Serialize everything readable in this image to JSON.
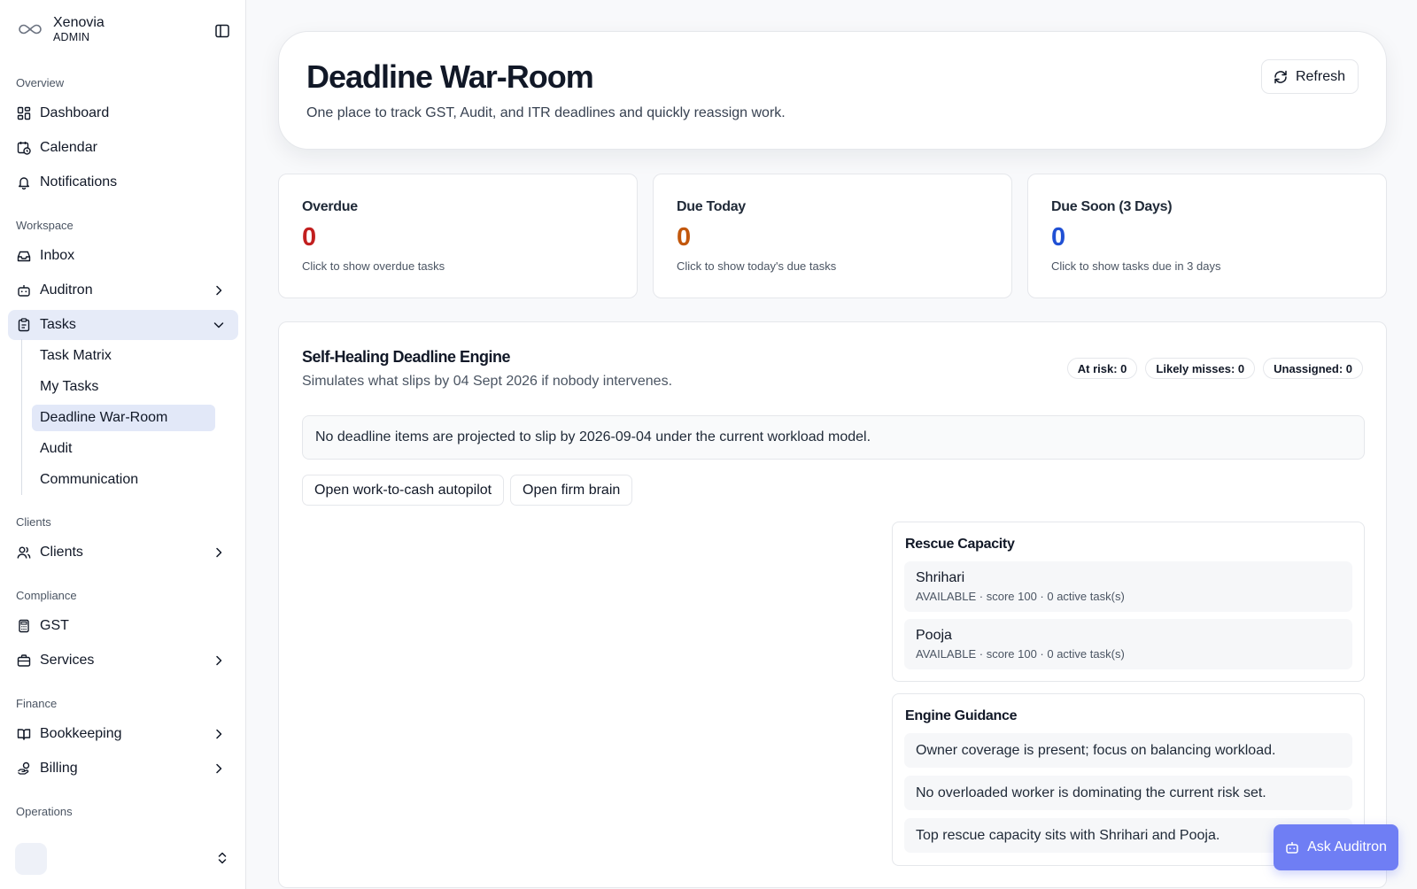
{
  "brand": {
    "name": "Xenovia",
    "role": "ADMIN"
  },
  "sidebar": {
    "sections": {
      "overview": "Overview",
      "workspace": "Workspace",
      "clients": "Clients",
      "compliance": "Compliance",
      "finance": "Finance",
      "operations": "Operations"
    },
    "items": {
      "dashboard": "Dashboard",
      "calendar": "Calendar",
      "notifications": "Notifications",
      "inbox": "Inbox",
      "auditron": "Auditron",
      "tasks": "Tasks",
      "clients": "Clients",
      "gst": "GST",
      "services": "Services",
      "bookkeeping": "Bookkeeping",
      "billing": "Billing"
    },
    "task_sub": {
      "task_matrix": "Task Matrix",
      "my_tasks": "My Tasks",
      "war_room": "Deadline War-Room",
      "audit": "Audit",
      "communication": "Communication"
    }
  },
  "header": {
    "title": "Deadline War-Room",
    "subtitle": "One place to track GST, Audit, and ITR deadlines and quickly reassign work.",
    "refresh_label": "Refresh"
  },
  "stats": [
    {
      "title": "Overdue",
      "value": "0",
      "desc": "Click to show overdue tasks",
      "color": "#c21f1f"
    },
    {
      "title": "Due Today",
      "value": "0",
      "desc": "Click to show today's due tasks",
      "color": "#c2570c"
    },
    {
      "title": "Due Soon (3 Days)",
      "value": "0",
      "desc": "Click to show tasks due in 3 days",
      "color": "#2050d4"
    }
  ],
  "engine": {
    "title": "Self-Healing Deadline Engine",
    "subtitle": "Simulates what slips by 04 Sept 2026 if nobody intervenes.",
    "pills": {
      "at_risk": "At risk: 0",
      "likely_misses": "Likely misses: 0",
      "unassigned": "Unassigned: 0"
    },
    "notice": "No deadline items are projected to slip by 2026-09-04 under the current workload model.",
    "buttons": {
      "autopilot": "Open work-to-cash autopilot",
      "firm_brain": "Open firm brain"
    },
    "rescue": {
      "title": "Rescue Capacity",
      "people": [
        {
          "name": "Shrihari",
          "meta": "AVAILABLE · score 100 · 0 active task(s)"
        },
        {
          "name": "Pooja",
          "meta": "AVAILABLE · score 100 · 0 active task(s)"
        }
      ]
    },
    "guidance": {
      "title": "Engine Guidance",
      "items": [
        "Owner coverage is present; focus on balancing workload.",
        "No overloaded worker is dominating the current risk set.",
        "Top rescue capacity sits with Shrihari and Pooja."
      ]
    }
  },
  "assistant": {
    "label": "Ask Auditron"
  },
  "colors": {
    "accent": "#6f7ef4",
    "active_nav": "#e6ebf8"
  }
}
